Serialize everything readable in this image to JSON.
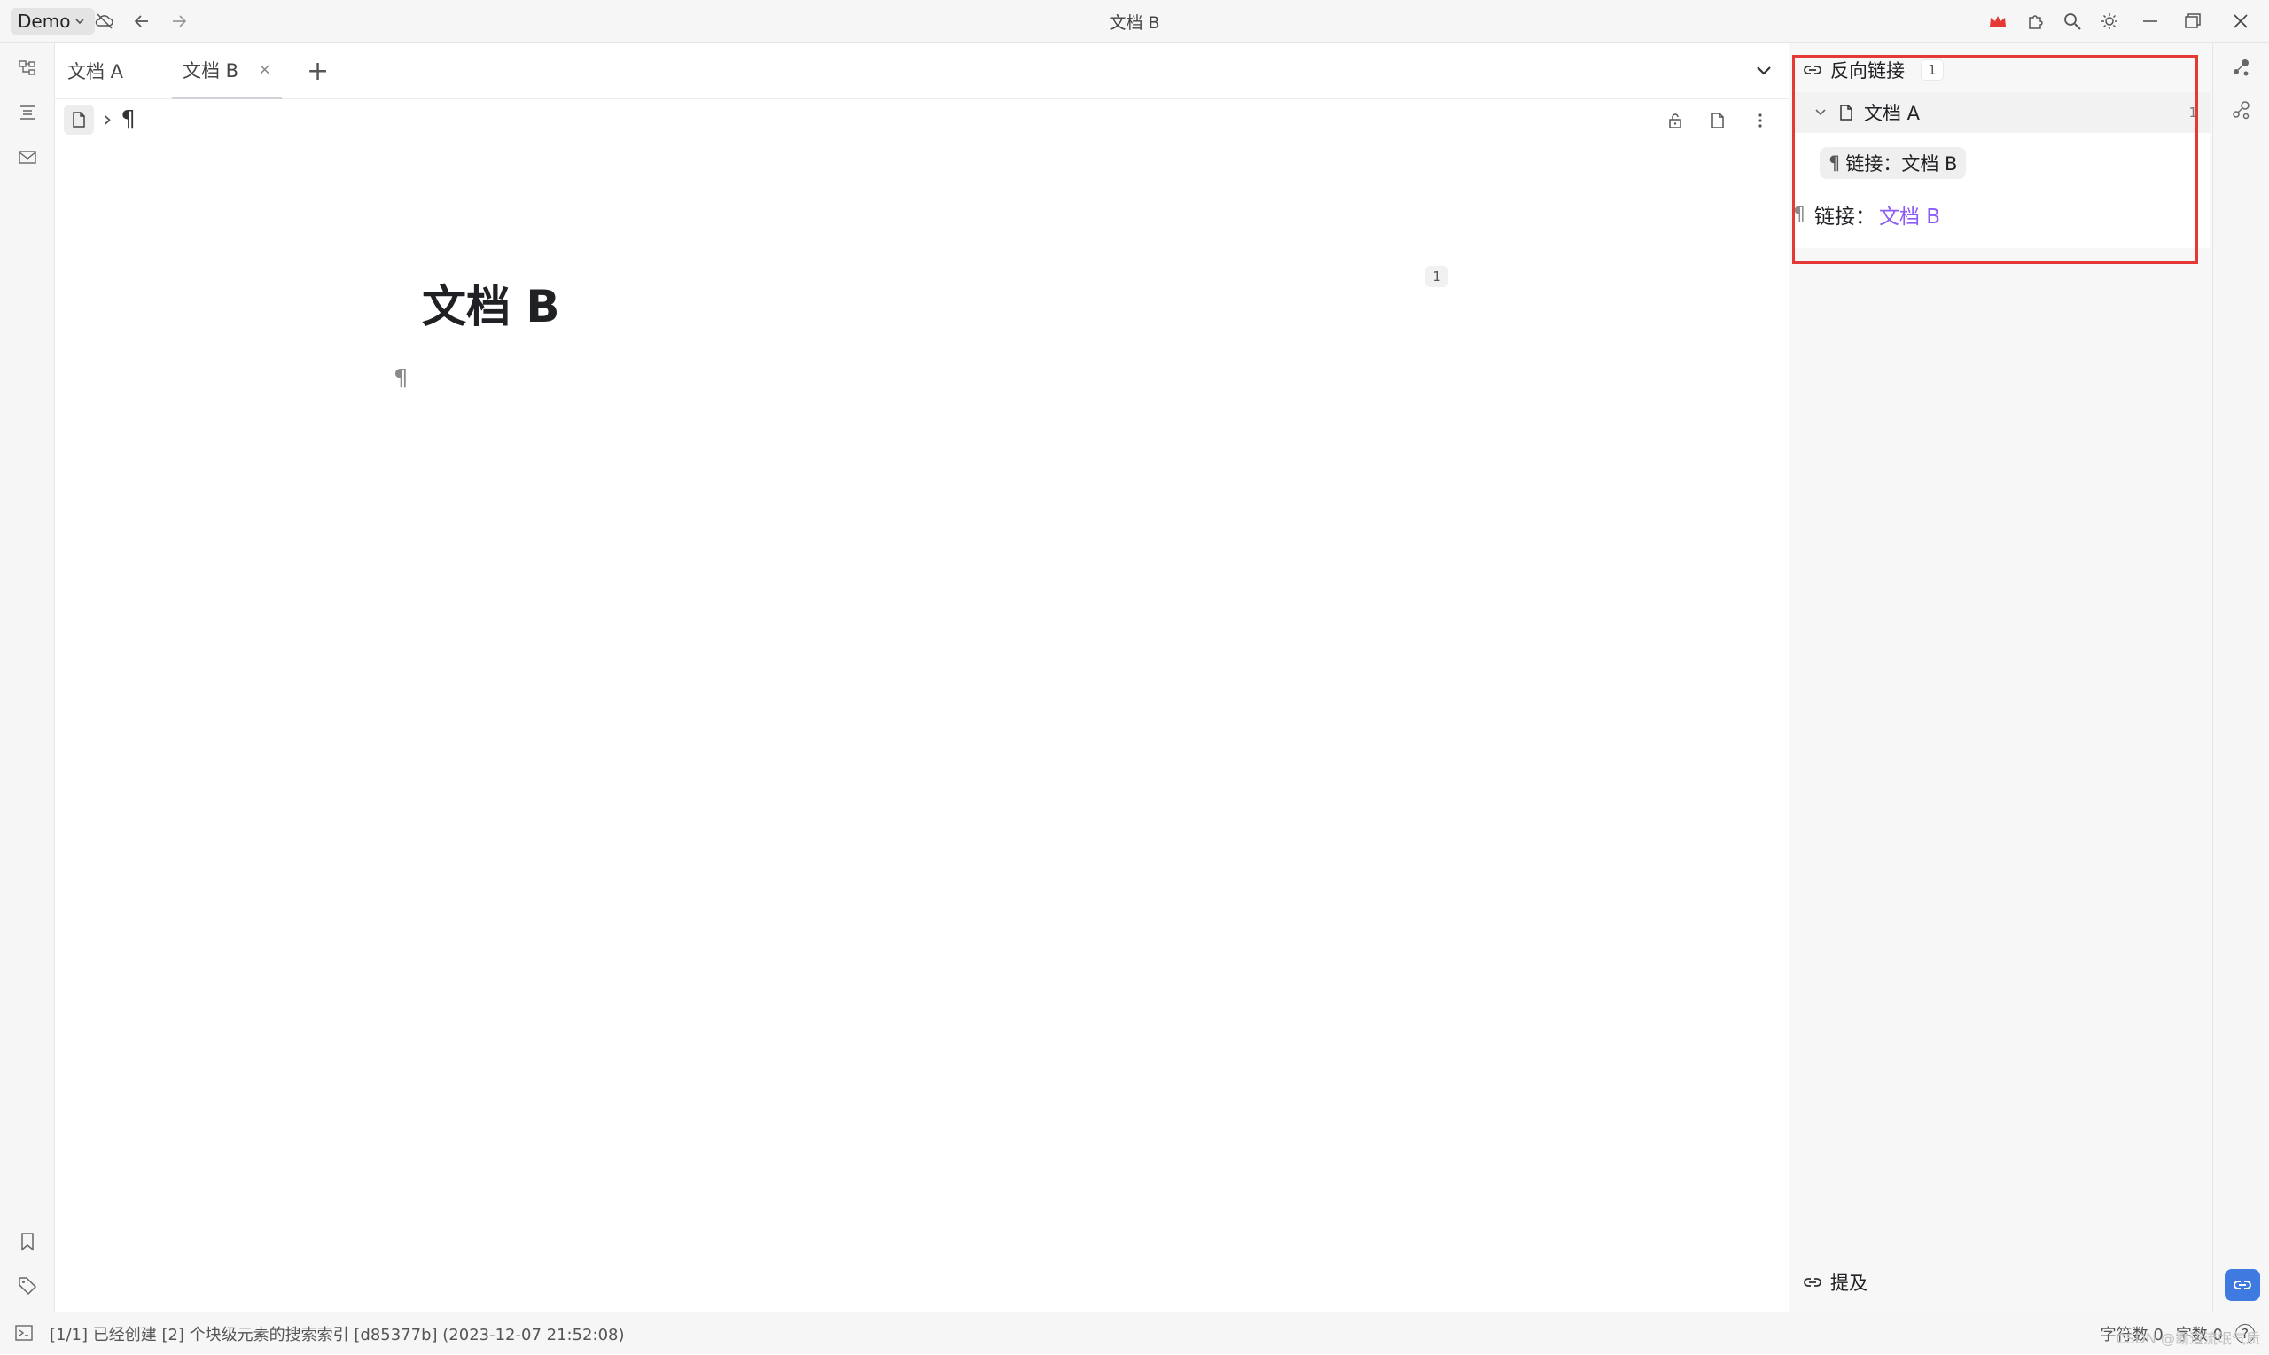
{
  "titlebar": {
    "workspace": "Demo",
    "title": "文档 B",
    "icons": [
      "cloud-off-icon",
      "back-arrow-icon",
      "forward-arrow-icon",
      "crown-icon",
      "plugin-icon",
      "search-icon",
      "theme-icon",
      "minimize-icon",
      "restore-icon",
      "close-icon"
    ],
    "crown_color": "#e53935"
  },
  "left_dock": {
    "icons": [
      "file-tree-icon",
      "outline-icon",
      "inbox-icon",
      "bookmark-icon",
      "tag-icon"
    ]
  },
  "tabs": [
    {
      "label": "文档 A",
      "active": false
    },
    {
      "label": "文档 B",
      "active": true,
      "close": "×"
    }
  ],
  "tabbar": {
    "add": "+"
  },
  "breadcrumb": {
    "separator": "›",
    "paragraph": "¶"
  },
  "editor": {
    "title": "文档 B",
    "backlink_count": "1",
    "paragraph_mark": "¶"
  },
  "backlinks": {
    "header": "反向链接",
    "count": "1",
    "doc": {
      "name": "文档 A",
      "count": "1"
    },
    "chip": "链接：文档 B",
    "line": {
      "prefix": "链接：",
      "link": "文档 B"
    },
    "link_color": "#8b5cf6",
    "highlight_color": "#e53935"
  },
  "mentions": {
    "header": "提及"
  },
  "right_dock": {
    "icons": [
      "graph-icon",
      "global-graph-icon",
      "backlink-icon"
    ],
    "active_color": "#3f7ae0"
  },
  "status": {
    "message": "[1/1] 已经创建 [2] 个块级元素的搜索索引 [d85377b] (2023-12-07 21:52:08)",
    "chars": "字符数 0",
    "words": "字数 0",
    "help": "?",
    "watermark": "CSDN @霸道流氓气质"
  }
}
